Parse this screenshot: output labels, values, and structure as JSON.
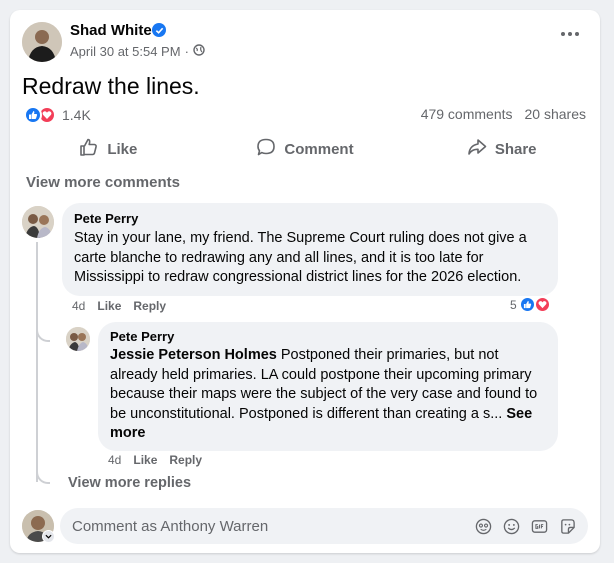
{
  "post": {
    "author": "Shad White",
    "timestamp": "April 30 at 5:54 PM",
    "text": "Redraw the lines.",
    "reaction_count": "1.4K",
    "comments_count": "479 comments",
    "shares_count": "20 shares",
    "verified": true
  },
  "actions": {
    "like": "Like",
    "comment": "Comment",
    "share": "Share"
  },
  "comments_section": {
    "view_more_comments": "View more comments",
    "view_more_replies": "View more replies"
  },
  "comment": {
    "author": "Pete Perry",
    "text": "Stay in your lane, my friend. The Supreme Court ruling does not give a carte blanche to redrawing any and all lines, and it is too late for Mississippi to redraw congressional district lines for the 2026 election.",
    "time": "4d",
    "like": "Like",
    "reply": "Reply",
    "reaction_count": "5"
  },
  "reply": {
    "author": "Pete Perry",
    "mention": "Jessie Peterson Holmes",
    "text": "Postponed their primaries, but not already held primaries. LA could postpone their upcoming primary because their maps were the subject of the very case and found to be unconstitutional. Postponed is different than creating a s...",
    "see_more": "See more",
    "time": "4d",
    "like": "Like",
    "reply": "Reply"
  },
  "composer": {
    "placeholder": "Comment as Anthony Warren"
  },
  "colors": {
    "like_blue": "#1877f2",
    "love_red": "#f33e58",
    "secondary_text": "#65676b"
  }
}
